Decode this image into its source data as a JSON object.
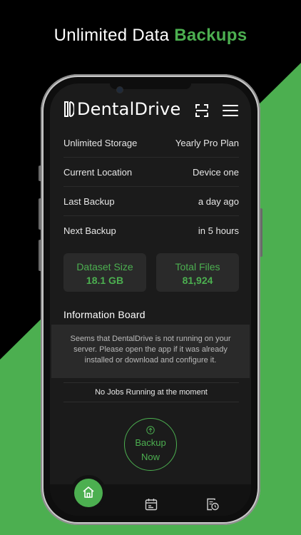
{
  "headline": {
    "text": "Unlimited Data ",
    "accent": "Backups"
  },
  "header": {
    "app_name": "DentalDrive",
    "scan_icon": "scan-icon",
    "menu_icon": "menu-icon"
  },
  "info_rows": [
    {
      "label": "Unlimited Storage",
      "value": "Yearly Pro Plan"
    },
    {
      "label": "Current Location",
      "value": "Device one"
    },
    {
      "label": "Last Backup",
      "value": "a day ago"
    },
    {
      "label": "Next Backup",
      "value": "in 5 hours"
    }
  ],
  "stats": {
    "dataset": {
      "label": "Dataset Size",
      "value": "18.1 GB"
    },
    "files": {
      "label": "Total Files",
      "value": "81,924"
    }
  },
  "board": {
    "title": "Information Board",
    "message": "Seems that DentalDrive is not running  on your server. Please open the app if it was already installed or download and configure it."
  },
  "jobs_status": "No Jobs Running at the moment",
  "backup_button": {
    "label": "Backup Now"
  },
  "nav": {
    "items": [
      "home-icon",
      "calendar-icon",
      "history-icon"
    ],
    "active": "home-icon"
  },
  "colors": {
    "accent": "#4caf50",
    "background": "#000000",
    "screen": "#1b1b1b",
    "card": "#2a2a2a"
  }
}
